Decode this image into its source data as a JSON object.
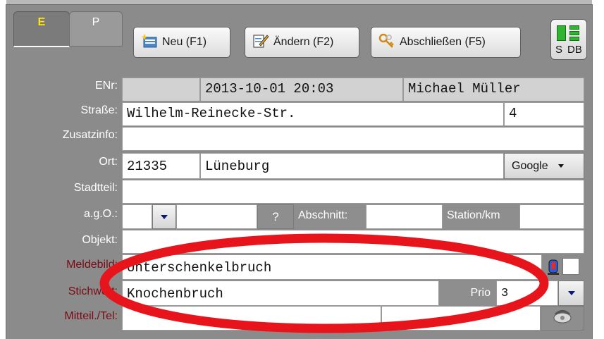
{
  "tabs": [
    {
      "label": "E"
    },
    {
      "label": "P"
    }
  ],
  "toolbar": {
    "new_label": "Neu (F1)",
    "edit_label": "Ändern (F2)",
    "close_label": "Abschließen (F5)"
  },
  "status": {
    "s_label": "S",
    "db_label": "DB"
  },
  "form": {
    "enr": {
      "label": "ENr:",
      "number": "",
      "datetime": "2013-10-01 20:03",
      "user": "Michael Müller"
    },
    "street": {
      "label": "Straße:",
      "value": "Wilhelm-Reinecke-Str.",
      "house_no": "4"
    },
    "extra": {
      "label": "Zusatzinfo:",
      "value": ""
    },
    "place": {
      "label": "Ort:",
      "zip": "21335",
      "city": "Lüneburg",
      "map_button": "Google"
    },
    "district": {
      "label": "Stadtteil:",
      "value": ""
    },
    "ago": {
      "label": "a.g.O.:",
      "help_button": "?",
      "section_label": "Abschnitt:",
      "station_label": "Station/km"
    },
    "object": {
      "label": "Objekt:",
      "value": ""
    },
    "report": {
      "label": "Meldebild:",
      "value": "Unterschenkelbruch"
    },
    "keyword": {
      "label": "Stichwort:",
      "value": "Knochenbruch",
      "prio_label": "Prio",
      "prio_value": "3"
    },
    "message": {
      "label": "Mitteil./Tel:",
      "value": ""
    }
  },
  "colors": {
    "panel": "#8b8b8b",
    "highlight_ellipse": "#e8141b",
    "label_red": "#7a0a14",
    "tab_active_text": "#ffe21a"
  }
}
